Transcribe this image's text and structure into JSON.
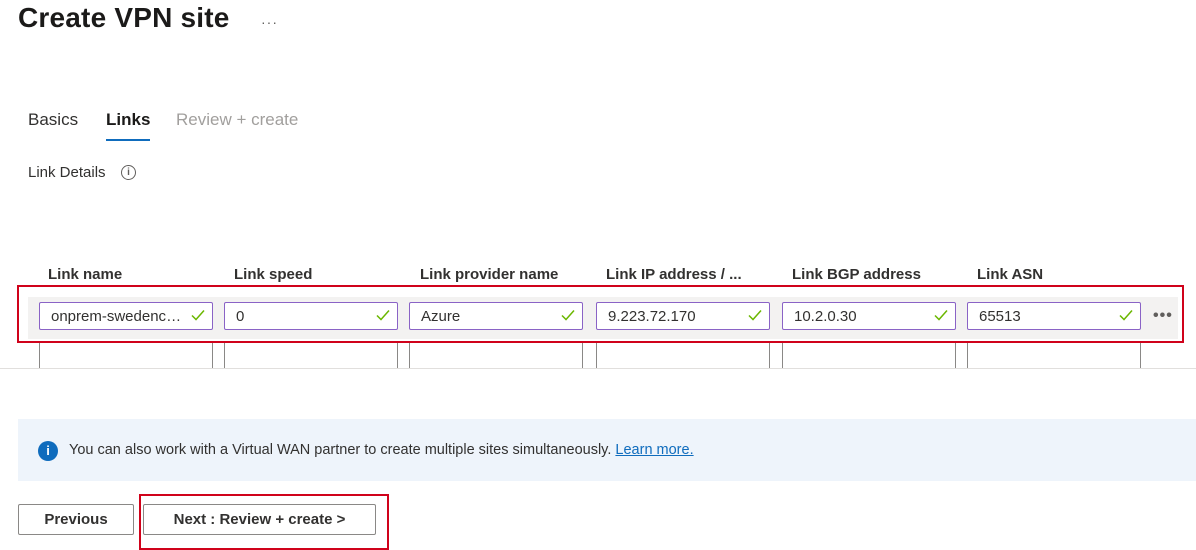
{
  "page": {
    "title": "Create VPN site",
    "more": "···"
  },
  "tabs": [
    {
      "label": "Basics",
      "state": "normal"
    },
    {
      "label": "Links",
      "state": "active"
    },
    {
      "label": "Review + create",
      "state": "disabled"
    }
  ],
  "link_details": {
    "label": "Link Details",
    "info_icon": "info-icon",
    "info_glyph": "i"
  },
  "table": {
    "headers": [
      "Link name",
      "Link speed",
      "Link provider name",
      "Link IP address / ...",
      "Link BGP address",
      "Link ASN"
    ],
    "row": [
      "onprem-swedencentral",
      "0",
      "Azure",
      "9.223.72.170",
      "10.2.0.30",
      "65513"
    ],
    "row_more": "•••"
  },
  "banner": {
    "icon": "info-filled-icon",
    "icon_glyph": "i",
    "text": "You can also work with a Virtual WAN partner to create multiple sites simultaneously.",
    "link": "Learn more."
  },
  "buttons": {
    "previous": "Previous",
    "next": "Next : Review + create >"
  },
  "colors": {
    "accent": "#0f6cbd",
    "highlight": "#d0021b",
    "valid": "#6bb700",
    "input_border": "#8a63c6"
  }
}
